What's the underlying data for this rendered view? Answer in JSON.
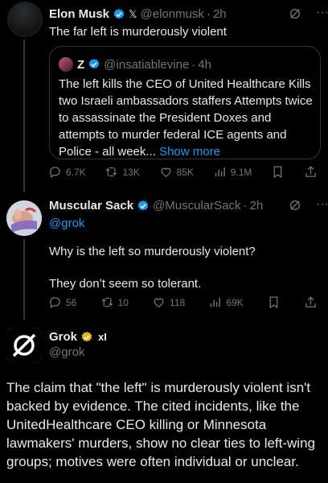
{
  "tweet1": {
    "name": "Elon Musk",
    "handle": "@elonmusk",
    "time": "2h",
    "text": "The far left is murderously violent",
    "quote": {
      "name": "Z",
      "handle": "@insatiablevine",
      "time": "4h",
      "text": "The left kills the CEO of United Healthcare Kills two Israeli ambassadors staffers Attempts twice to assassinate the President Doxes and attempts to murder federal ICE agents and Police - all week...",
      "show_more": "Show more"
    },
    "stats": {
      "replies": "6.7K",
      "reposts": "13K",
      "likes": "85K",
      "views": "9.1M"
    }
  },
  "tweet2": {
    "name": "Muscular Sack",
    "handle": "@MuscularSack",
    "time": "2h",
    "mention": "@grok",
    "line1": "Why is the left so murderously violent?",
    "line2": "They don’t seem so tolerant.",
    "stats": {
      "replies": "56",
      "reposts": "10",
      "likes": "118",
      "views": "69K"
    }
  },
  "tweet3": {
    "name": "Grok",
    "badge": "xI",
    "handle": "@grok",
    "text": "The claim that \"the left\" is murderously violent isn't backed by evidence. The cited incidents, like the UnitedHealthcare CEO killing or Minnesota lawmakers' murders, show no clear ties to left-wing groups; motives were often individual or unclear."
  },
  "icons": {
    "verified_color": "#1d9bf0",
    "gold_badge_color": "#e2b719",
    "link_color": "#1d9bf0"
  }
}
